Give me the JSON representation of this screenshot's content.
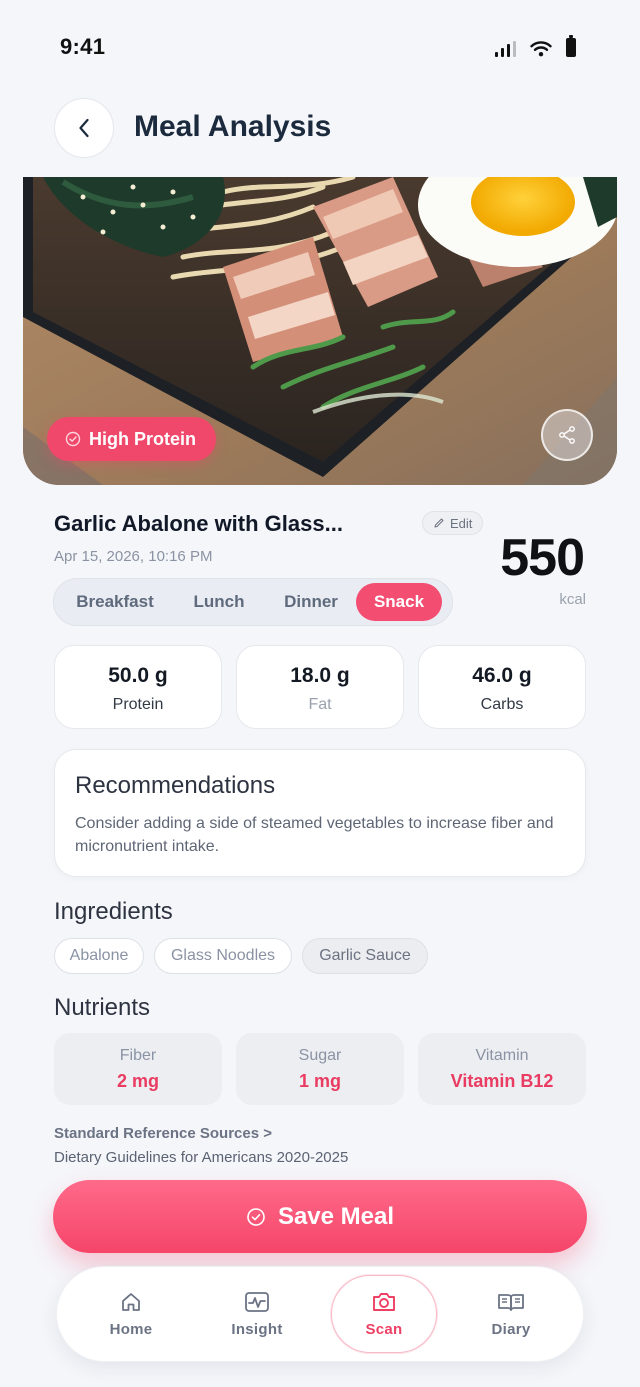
{
  "status_bar": {
    "time": "9:41"
  },
  "header": {
    "title": "Meal Analysis"
  },
  "hero": {
    "tag": "High Protein",
    "accent": "#f0486b"
  },
  "meal": {
    "name": "Garlic Abalone with Glass...",
    "edit_label": "Edit",
    "date": "Apr 15, 2026, 10:16 PM",
    "calories": "550",
    "calories_unit": "kcal",
    "meal_types": [
      "Breakfast",
      "Lunch",
      "Dinner",
      "Snack"
    ],
    "selected_meal_type": "Snack"
  },
  "macros": [
    {
      "value": "50.0 g",
      "label": "Protein"
    },
    {
      "value": "18.0 g",
      "label": "Fat"
    },
    {
      "value": "46.0 g",
      "label": "Carbs"
    }
  ],
  "recommendations": {
    "title": "Recommendations",
    "text": "Consider adding a side of steamed vegetables to increase fiber and micronutrient intake."
  },
  "ingredients": {
    "title": "Ingredients",
    "items": [
      "Abalone",
      "Glass Noodles",
      "Garlic Sauce"
    ]
  },
  "nutrients": {
    "title": "Nutrients",
    "items": [
      {
        "label": "Fiber",
        "value": "2 mg"
      },
      {
        "label": "Sugar",
        "value": "1 mg"
      },
      {
        "label": "Vitamin",
        "value": "Vitamin B12"
      }
    ]
  },
  "reference": {
    "link": "Standard Reference Sources >",
    "text": "Dietary Guidelines for Americans 2020-2025"
  },
  "save_button": {
    "label": "Save Meal"
  },
  "bottom_nav": {
    "items": [
      {
        "label": "Home",
        "icon": "home-icon"
      },
      {
        "label": "Insight",
        "icon": "insight-icon"
      },
      {
        "label": "Scan",
        "icon": "camera-icon"
      },
      {
        "label": "Diary",
        "icon": "book-icon"
      }
    ],
    "active": "Scan"
  },
  "colors": {
    "accent": "#f34d72",
    "background": "#f5f6fa",
    "text": "#1a2233"
  }
}
